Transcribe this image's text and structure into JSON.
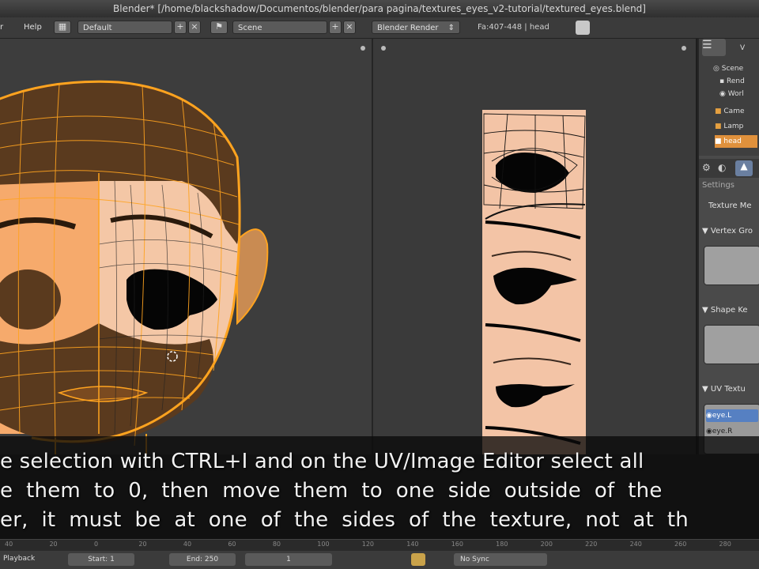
{
  "window": {
    "title": "Blender* [/home/blackshadow/Documentos/blender/para pagina/textures_eyes_v2-tutorial/textured_eyes.blend]"
  },
  "info_header": {
    "menu_help": "Help",
    "layout_value": "Default",
    "scene_value": "Scene",
    "render_engine": "Blender Render",
    "stats": "Fa:407-448 | head",
    "partial_menu": "r"
  },
  "outliner": {
    "items": [
      "Scene",
      "Rend",
      "Worl",
      "Came",
      "Lamp",
      "head"
    ],
    "view_label": "V"
  },
  "properties": {
    "settings_label": "Settings",
    "texture_mesh_label": "Texture Me",
    "vertex_groups_label": "Vertex Gro",
    "shape_keys_label": "Shape Ke",
    "uv_textures_label": "UV Textu",
    "uv_items": [
      "eye.L",
      "eye.R"
    ]
  },
  "timeline": {
    "playback": "Playback",
    "start": "Start: 1",
    "end": "End: 250",
    "frame": "1",
    "sync": "No Sync",
    "ticks": [
      "40",
      "20",
      "0",
      "20",
      "40",
      "60",
      "80",
      "100",
      "120",
      "140",
      "160",
      "180",
      "200",
      "220",
      "240",
      "260",
      "280"
    ]
  },
  "caption": {
    "lines": [
      "e selection with CTRL+I and on the UV/Image Editor select all",
      "e  them  to  0,  then  move  them  to  one  side  outside  of  the",
      "er,  it  must  be  at  one  of  the  sides  of  the  texture,  not  at  th"
    ]
  },
  "colors": {
    "mesh_wire": "#ffa31f",
    "hair_brown": "#5a3a1e",
    "skin": "#f3c6a5",
    "eye_black": "#050505",
    "bg_dark": "#3d3d3d",
    "selected_blue": "#5680c2"
  }
}
